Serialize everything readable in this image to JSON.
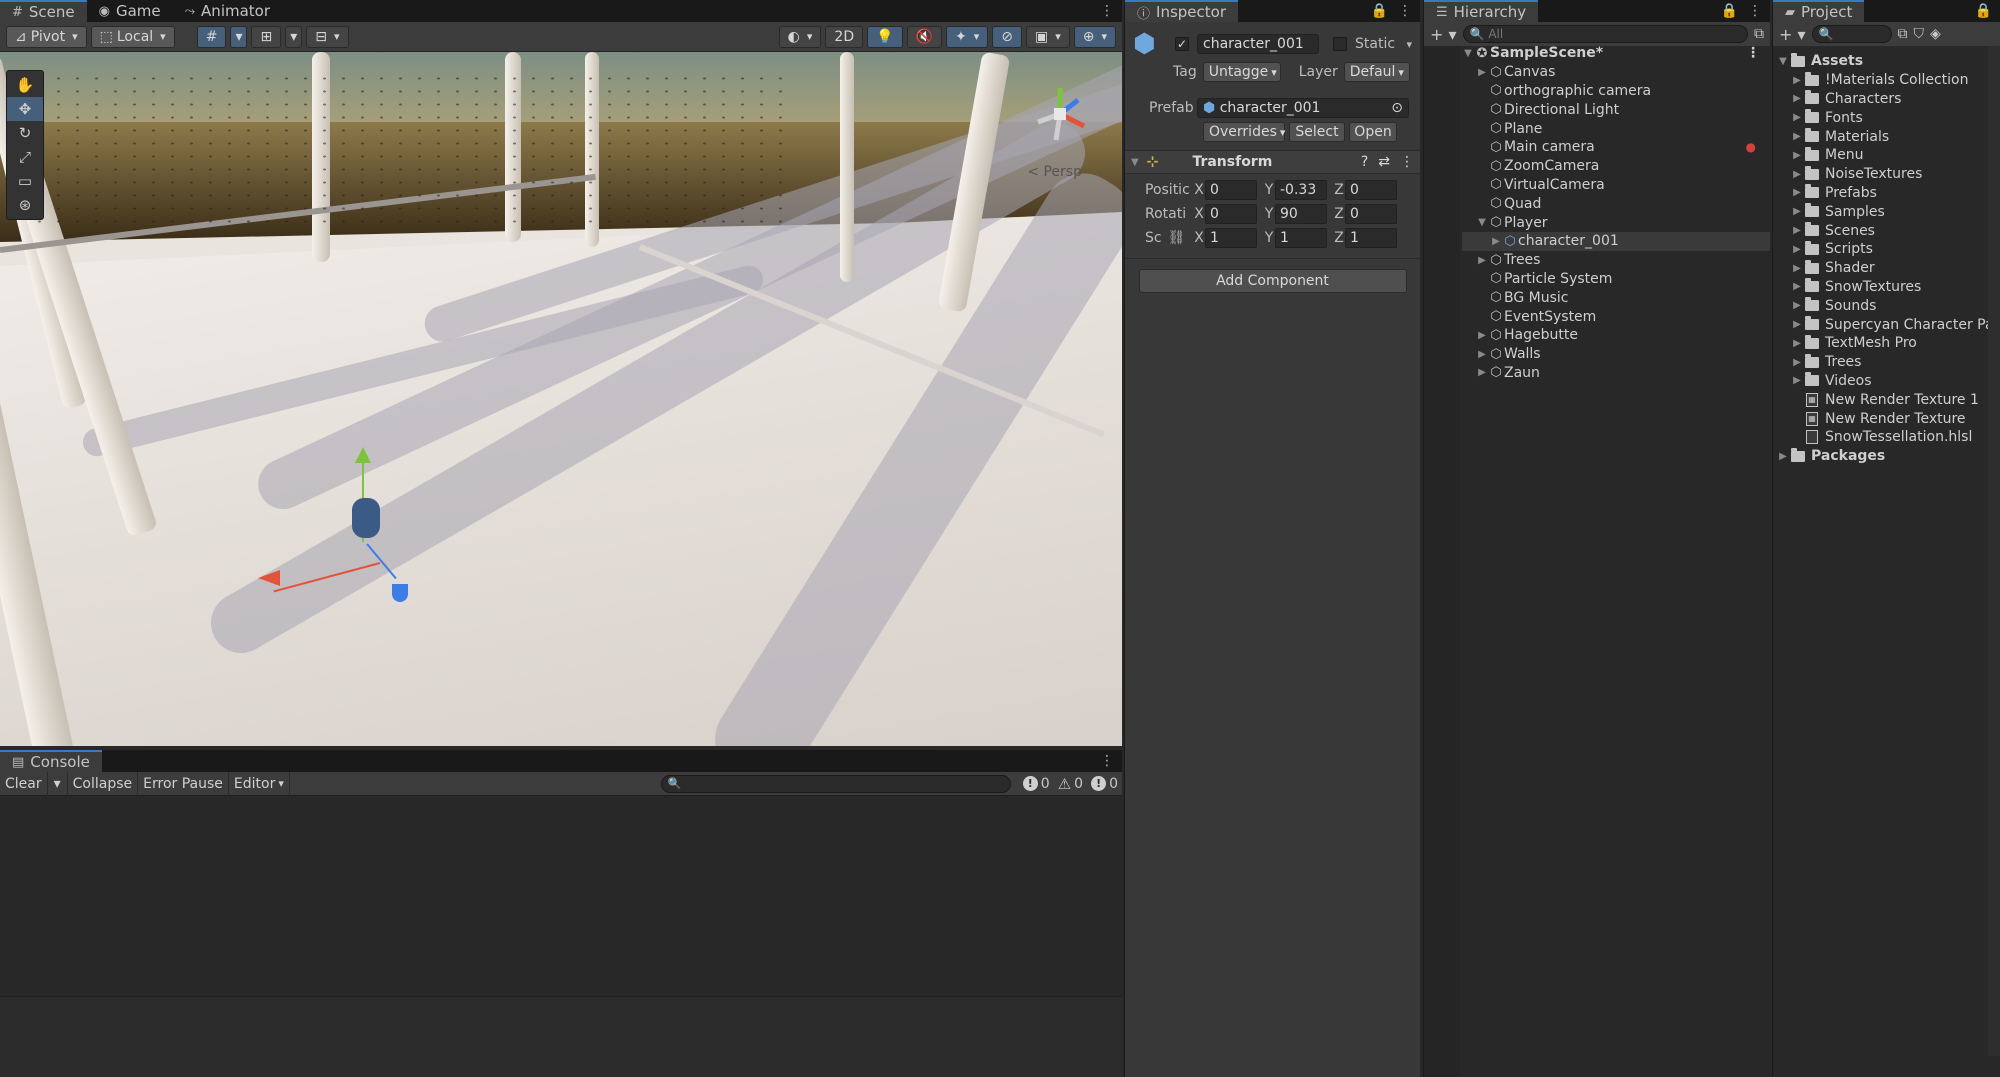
{
  "scene_tabs": [
    {
      "icon": "grid-icon",
      "label": "Scene"
    },
    {
      "icon": "gamepad-icon",
      "label": "Game"
    },
    {
      "icon": "animator-icon",
      "label": "Animator"
    }
  ],
  "scene_toolbar": {
    "pivot": "Pivot",
    "local": "Local",
    "mode_2d": "2D"
  },
  "scene_view": {
    "projection_label": "< Persp",
    "tools": [
      "hand-tool",
      "move-tool",
      "rotate-tool",
      "scale-tool",
      "rect-tool",
      "transform-tool"
    ]
  },
  "console": {
    "tab": "Console",
    "buttons": {
      "clear": "Clear",
      "collapse": "Collapse",
      "error_pause": "Error Pause",
      "editor": "Editor"
    },
    "counts": {
      "info": "0",
      "warning": "0",
      "error": "0"
    }
  },
  "inspector": {
    "tab": "Inspector",
    "object_name": "character_001",
    "static_label": "Static",
    "tag_label": "Tag",
    "tag_value": "Untagge",
    "layer_label": "Layer",
    "layer_value": "Defaul",
    "prefab_label": "Prefab",
    "prefab_value": "character_001",
    "overrides": "Overrides",
    "select": "Select",
    "open": "Open",
    "transform": {
      "title": "Transform",
      "position_label": "Positic",
      "rotation_label": "Rotati",
      "scale_label": "Sc",
      "position": {
        "x": "0",
        "y": "-0.33",
        "z": "0"
      },
      "rotation": {
        "x": "0",
        "y": "90",
        "z": "0"
      },
      "scale": {
        "x": "1",
        "y": "1",
        "z": "1"
      }
    },
    "add_component": "Add Component"
  },
  "hierarchy": {
    "tab": "Hierarchy",
    "search_placeholder": "All",
    "scene": "SampleScene*",
    "items": [
      {
        "label": "Canvas",
        "depth": 1,
        "expandable": true
      },
      {
        "label": "orthographic camera",
        "depth": 1,
        "expandable": false
      },
      {
        "label": "Directional Light",
        "depth": 1,
        "expandable": false
      },
      {
        "label": "Plane",
        "depth": 1,
        "expandable": false
      },
      {
        "label": "Main camera",
        "depth": 1,
        "expandable": false
      },
      {
        "label": "ZoomCamera",
        "depth": 1,
        "expandable": false
      },
      {
        "label": "VirtualCamera",
        "depth": 1,
        "expandable": false
      },
      {
        "label": "Quad",
        "depth": 1,
        "expandable": false
      },
      {
        "label": "Player",
        "depth": 1,
        "expandable": true,
        "expanded": true
      },
      {
        "label": "character_001",
        "depth": 2,
        "expandable": true,
        "selected": true,
        "prefab": true
      },
      {
        "label": "Trees",
        "depth": 1,
        "expandable": true
      },
      {
        "label": "Particle System",
        "depth": 1,
        "expandable": false
      },
      {
        "label": "BG Music",
        "depth": 1,
        "expandable": false
      },
      {
        "label": "EventSystem",
        "depth": 1,
        "expandable": false
      },
      {
        "label": "Hagebutte",
        "depth": 1,
        "expandable": true
      },
      {
        "label": "Walls",
        "depth": 1,
        "expandable": true
      },
      {
        "label": "Zaun",
        "depth": 1,
        "expandable": true
      }
    ]
  },
  "project": {
    "tab": "Project",
    "assets_root": "Assets",
    "folders": [
      "!Materials Collection",
      "Characters",
      "Fonts",
      "Materials",
      "Menu",
      "NoiseTextures",
      "Prefabs",
      "Samples",
      "Scenes",
      "Scripts",
      "Shader",
      "SnowTextures",
      "Sounds",
      "Supercyan Character Pa",
      "TextMesh Pro",
      "Trees",
      "Videos"
    ],
    "files": [
      "New Render Texture 1",
      "New Render Texture",
      "SnowTessellation.hlsl"
    ],
    "packages": "Packages"
  },
  "colors": {
    "accent": "#3a79bb",
    "selection": "#46607c",
    "panel": "#383838",
    "background": "#282828"
  }
}
